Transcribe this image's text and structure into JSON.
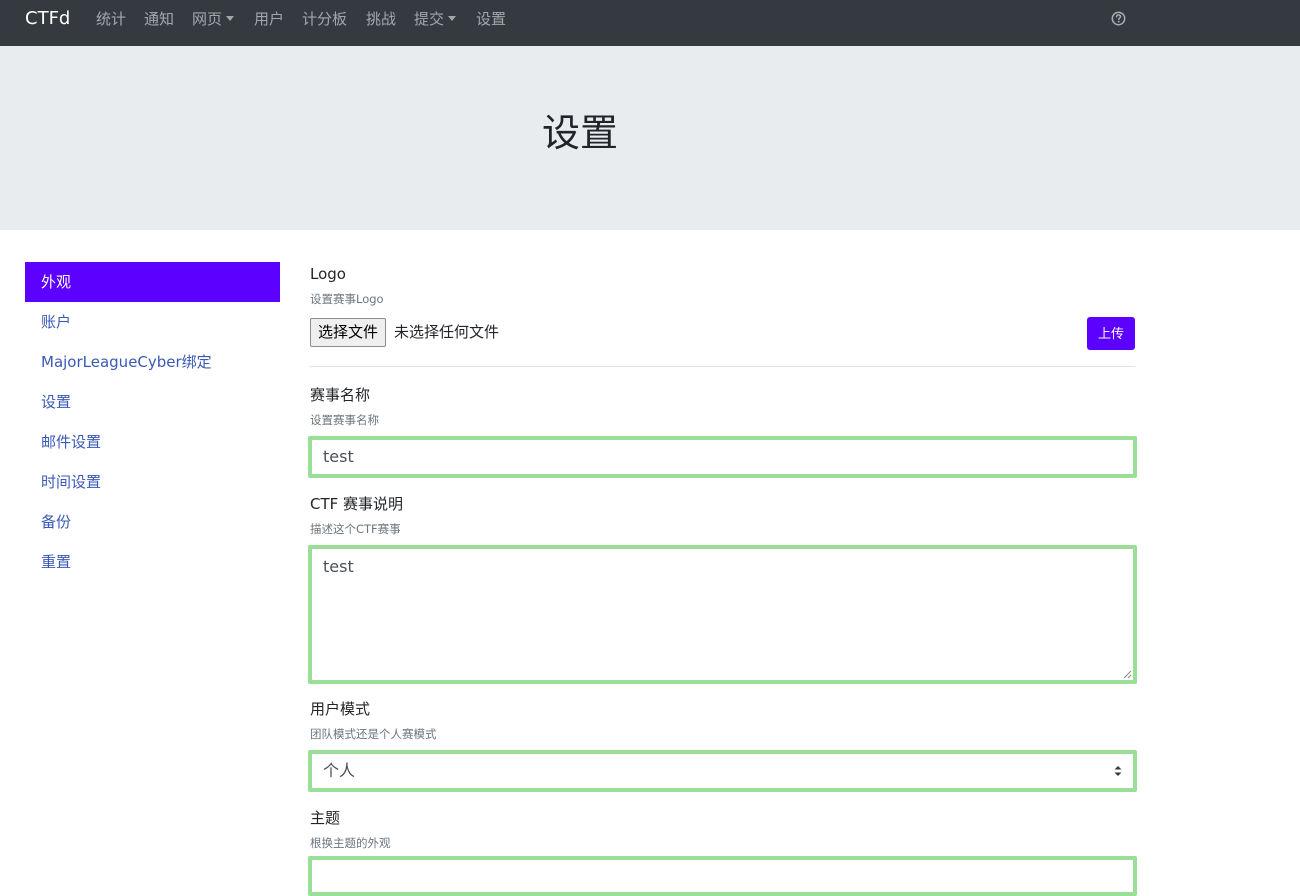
{
  "navbar": {
    "brand": "CTFd",
    "items": [
      {
        "label": "统计"
      },
      {
        "label": "通知"
      },
      {
        "label": "网页",
        "dropdown": true
      },
      {
        "label": "用户"
      },
      {
        "label": "计分板"
      },
      {
        "label": "挑战"
      },
      {
        "label": "提交",
        "dropdown": true
      },
      {
        "label": "设置"
      }
    ],
    "help_icon": "question-circle-icon"
  },
  "header": {
    "title": "设置"
  },
  "sidebar": {
    "items": [
      {
        "label": "外观",
        "active": true
      },
      {
        "label": "账户"
      },
      {
        "label": "MajorLeagueCyber绑定"
      },
      {
        "label": "设置"
      },
      {
        "label": "邮件设置"
      },
      {
        "label": "时间设置"
      },
      {
        "label": "备份"
      },
      {
        "label": "重置"
      }
    ]
  },
  "form": {
    "logo": {
      "label": "Logo",
      "help": "设置赛事Logo",
      "choose_file": "选择文件",
      "no_file": "未选择任何文件",
      "upload": "上传"
    },
    "ctf_name": {
      "label": "赛事名称",
      "help": "设置赛事名称",
      "value": "test"
    },
    "ctf_description": {
      "label": "CTF 赛事说明",
      "help": "描述这个CTF赛事",
      "value": "test"
    },
    "user_mode": {
      "label": "用户模式",
      "help": "团队模式还是个人赛模式",
      "value": "个人"
    },
    "theme": {
      "label": "主题",
      "help": "根换主题的外观"
    }
  },
  "colors": {
    "navbar_bg": "#343a40",
    "accent": "#5c00ff",
    "input_focus_border": "#9ade97",
    "link": "#3a59b6",
    "jumbotron_bg": "#e9ecef"
  }
}
